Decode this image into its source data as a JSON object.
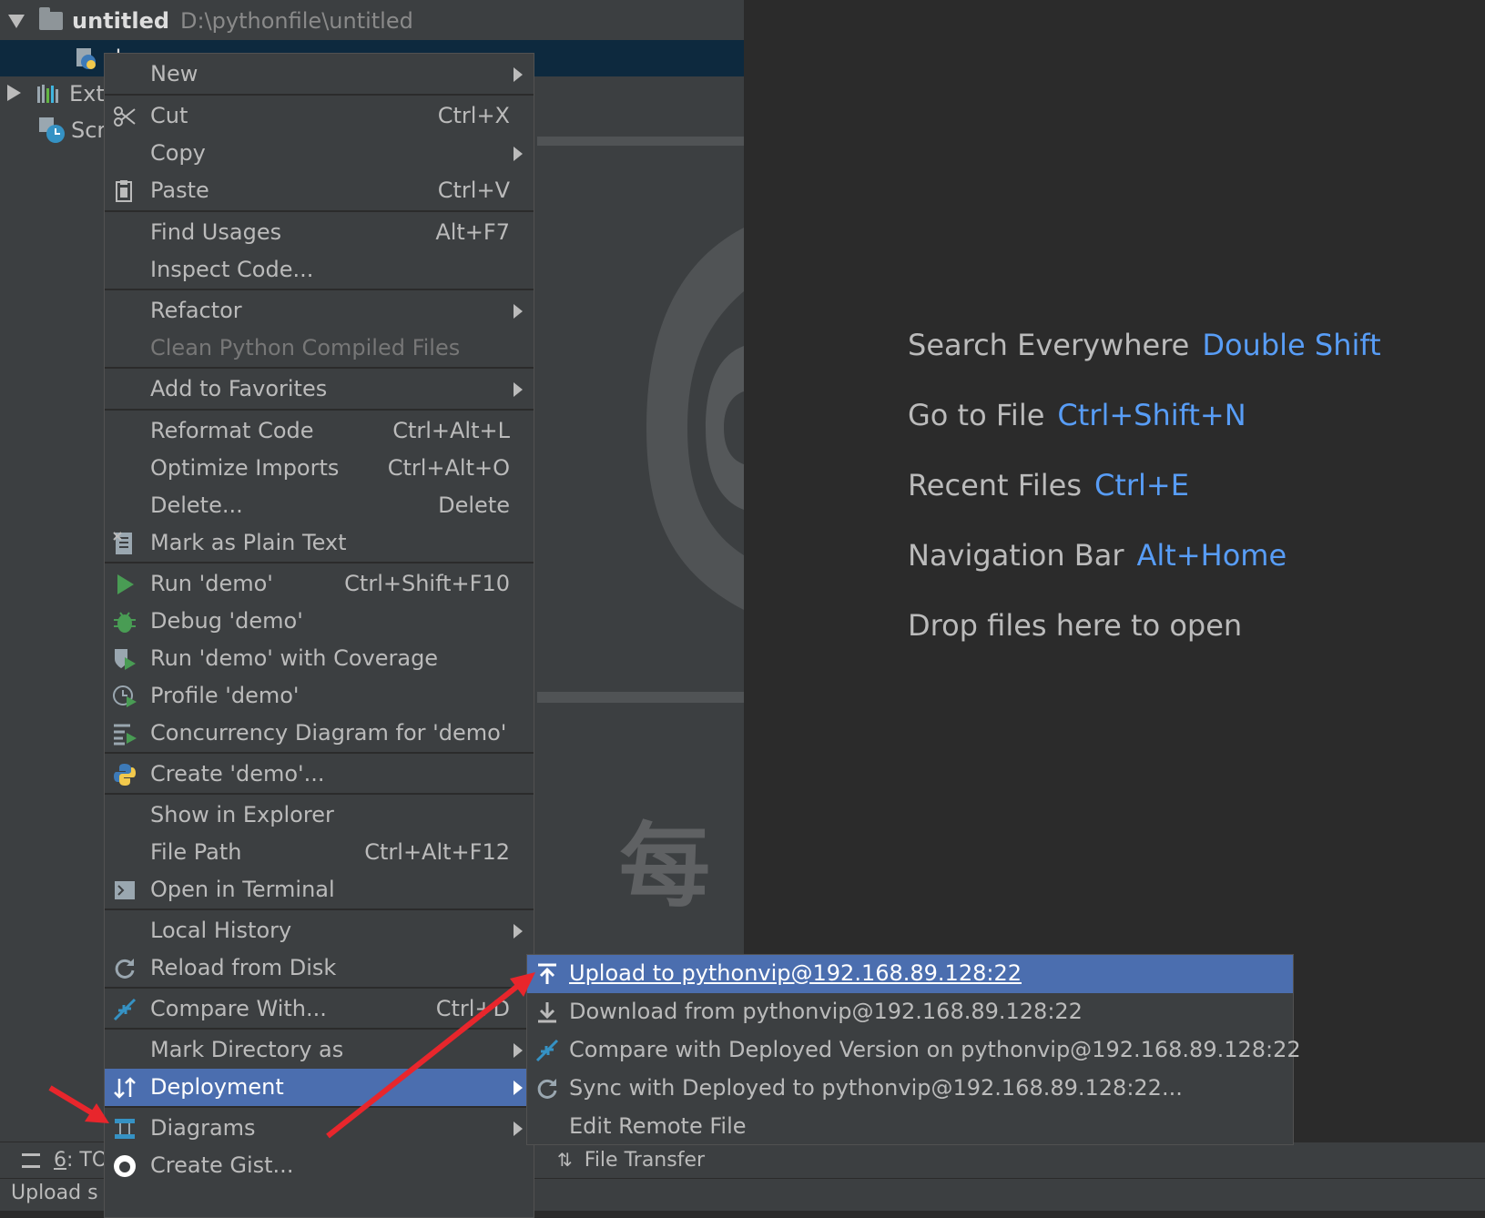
{
  "project": {
    "root_name": "untitled",
    "root_path": "D:\\pythonfile\\untitled",
    "selected_file": "d",
    "external_libraries": "Ext",
    "scratches": "Scr"
  },
  "welcome": {
    "search_label": "Search Everywhere",
    "search_key": "Double Shift",
    "goto_label": "Go to File",
    "goto_key": "Ctrl+Shift+N",
    "recent_label": "Recent Files",
    "recent_key": "Ctrl+E",
    "nav_label": "Navigation Bar",
    "nav_key": "Alt+Home",
    "drop_label": "Drop files here to open",
    "watermark_char": "每"
  },
  "menu": {
    "new": "New",
    "cut": "Cut",
    "cut_sc": "Ctrl+X",
    "copy": "Copy",
    "paste": "Paste",
    "paste_sc": "Ctrl+V",
    "find_usages": "Find Usages",
    "find_usages_sc": "Alt+F7",
    "inspect": "Inspect Code...",
    "refactor": "Refactor",
    "clean": "Clean Python Compiled Files",
    "favorites": "Add to Favorites",
    "reformat": "Reformat Code",
    "reformat_sc": "Ctrl+Alt+L",
    "optimize": "Optimize Imports",
    "optimize_sc": "Ctrl+Alt+O",
    "delete": "Delete...",
    "delete_sc": "Delete",
    "plain": "Mark as Plain Text",
    "run": "Run 'demo'",
    "run_sc": "Ctrl+Shift+F10",
    "debug": "Debug 'demo'",
    "coverage": "Run 'demo' with Coverage",
    "profile": "Profile 'demo'",
    "concurrency": "Concurrency Diagram for 'demo'",
    "create": "Create 'demo'...",
    "explorer": "Show in Explorer",
    "filepath": "File Path",
    "filepath_sc": "Ctrl+Alt+F12",
    "terminal": "Open in Terminal",
    "history": "Local History",
    "reload": "Reload from Disk",
    "compare": "Compare With...",
    "compare_sc": "Ctrl+D",
    "markdir": "Mark Directory as",
    "deployment": "Deployment",
    "diagrams": "Diagrams",
    "gist": "Create Gist..."
  },
  "submenu": {
    "upload": "Upload to pythonvip@192.168.89.128:22",
    "download": "Download from pythonvip@192.168.89.128:22",
    "compare": "Compare with Deployed Version on pythonvip@192.168.89.128:22",
    "sync": "Sync with Deployed to pythonvip@192.168.89.128:22...",
    "edit": "Edit Remote File"
  },
  "bottom": {
    "todo_num": "6",
    "todo_label": ": TO",
    "file_transfer": "File Transfer",
    "status": "Upload s"
  },
  "colors": {
    "highlight": "#4b6eaf",
    "shortcut_blue": "#589df6",
    "panel": "#3c3f41",
    "editor": "#2b2b2b",
    "arrow_red": "#e8262c"
  }
}
